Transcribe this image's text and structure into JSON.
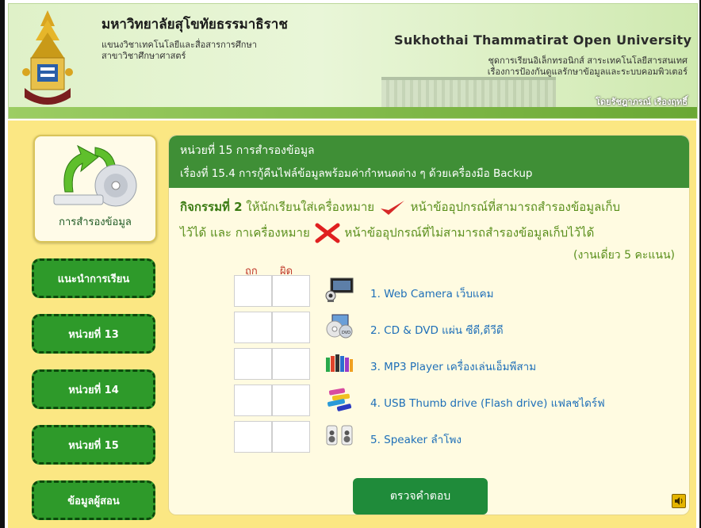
{
  "header": {
    "university_th": "มหาวิทยาลัยสุโขทัยธรรมาธิราช",
    "department": "แขนงวิชาเทคโนโลยีและสื่อสารการศึกษา",
    "branch": "สาขาวิชาศึกษาศาสตร์",
    "university_en": "Sukhothai Thammatirat Open University",
    "set_line1": "ชุดการเรียนอิเล็กทรอนิกส์ สาระเทคโนโลยีสารสนเทศ",
    "set_line2": "เรื่องการป้องกันดูแลรักษาข้อมูลและระบบคอมพิวเตอร์",
    "author": "โดยรัชฎาภรณ์ เรืองฤทธิ์"
  },
  "sidebar": {
    "logo_caption": "การสำรองข้อมูล",
    "items": [
      {
        "label": "แนะนำการเรียน"
      },
      {
        "label": "หน่วยที่ 13"
      },
      {
        "label": "หน่วยที่ 14"
      },
      {
        "label": "หน่วยที่ 15"
      },
      {
        "label": "ข้อมูลผู้สอน"
      }
    ]
  },
  "panel": {
    "unit": "หน่วยที่ 15 การสำรองข้อมูล",
    "topic": "เรื่องที่ 15.4 การกู้คืนไฟล์ข้อมูลพร้อมค่ากำหนดต่าง ๆ ด้วยเครื่องมือ Backup",
    "activity_title": "กิจกรรมที่ 2",
    "activity_part1": "ให้นักเรียนใส่เครื่องหมาย",
    "activity_part2": "หน้าข้ออุปกรณ์ที่สามารถสำรองข้อมูลเก็บ",
    "activity_part3": "ไว้ได้ และ กาเครื่องหมาย",
    "activity_part4": "หน้าข้ออุปกรณ์ที่ไม่สามารถสำรองข้อมูลเก็บไว้ได้",
    "score_note": "(งานเดี่ยว 5 คะแนน)",
    "col_true": "ถูก",
    "col_false": "ผิด",
    "items": [
      {
        "label": "1. Web Camera เว็บแคม",
        "icon": "webcam-icon"
      },
      {
        "label": "2. CD & DVD แผ่น ซีดี,ดีวีดี",
        "icon": "cd-dvd-icon"
      },
      {
        "label": "3. MP3 Player เครื่องเล่นเอ็มพีสาม",
        "icon": "mp3-player-icon"
      },
      {
        "label": "4. USB Thumb drive (Flash drive) แฟลชไดร์ฟ",
        "icon": "usb-drive-icon"
      },
      {
        "label": "5. Speaker ลำโพง",
        "icon": "speaker-icon"
      }
    ],
    "check_button": "ตรวจคำตอบ"
  },
  "colors": {
    "panel_header": "#3f8f36",
    "nav_button": "#2e9a2a",
    "background": "#fbe783",
    "check_mark": "#d62828",
    "cross_mark": "#e02020"
  }
}
